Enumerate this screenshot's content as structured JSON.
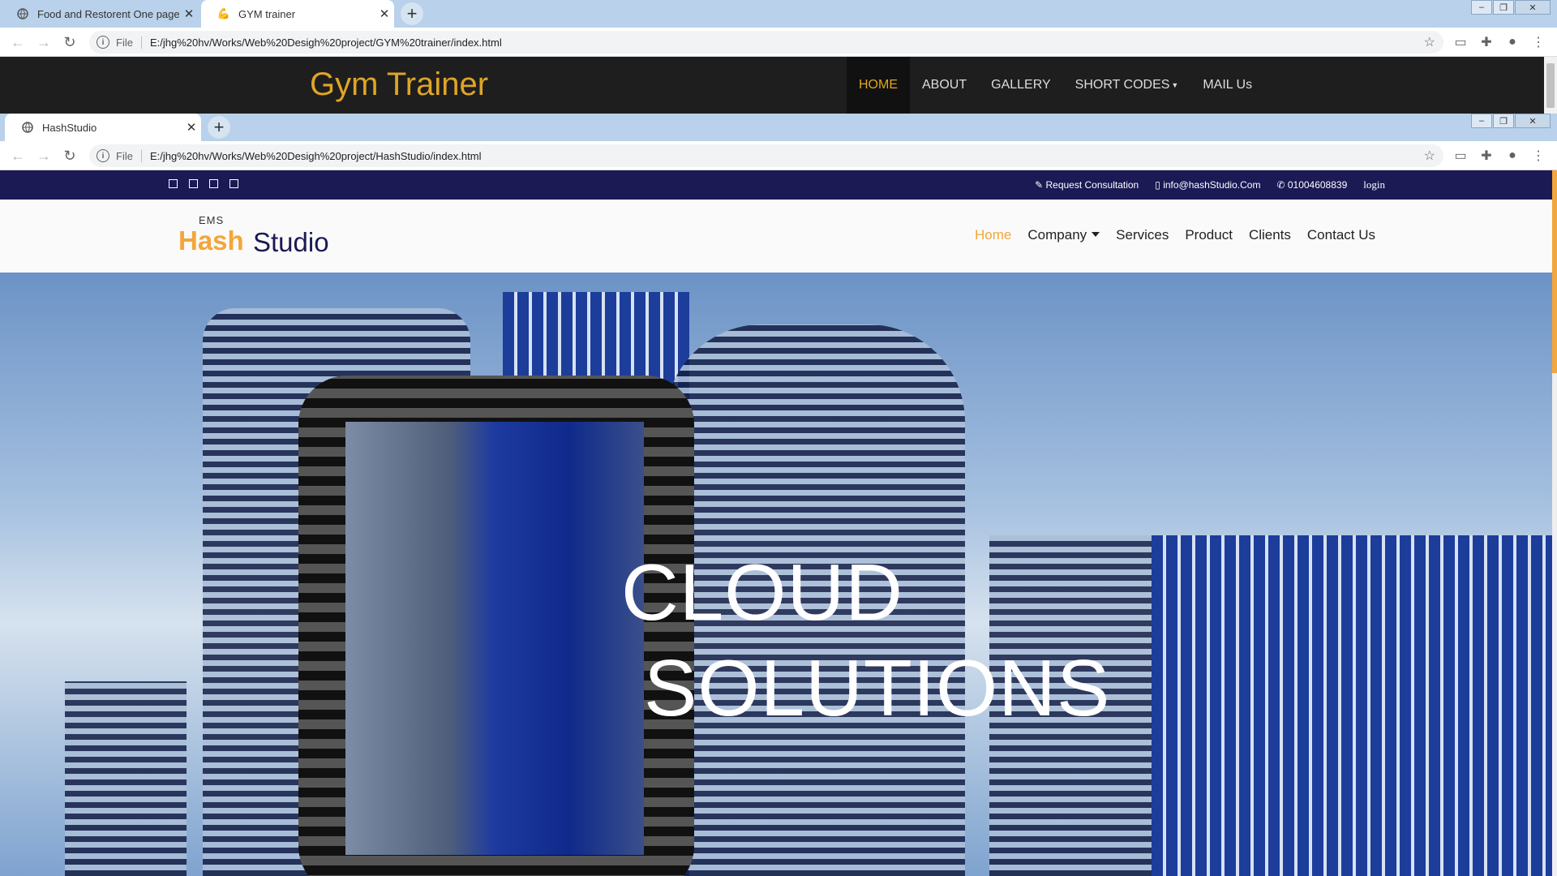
{
  "window1": {
    "tabs": [
      {
        "title": "Food and Restorent One page Te",
        "active": false
      },
      {
        "title": "GYM trainer",
        "active": true
      }
    ],
    "url_scheme": "File",
    "url": "E:/jhg%20hv/Works/Web%20Desigh%20project/GYM%20trainer/index.html"
  },
  "gym": {
    "title": "Gym Trainer",
    "menu": [
      "HOME",
      "ABOUT",
      "GALLERY",
      "SHORT CODES",
      "MAIL Us"
    ],
    "active": "HOME",
    "accent": "#e0a526",
    "bg": "#1e1e1e"
  },
  "window2": {
    "tabs": [
      {
        "title": "HashStudio",
        "active": true
      }
    ],
    "url_scheme": "File",
    "url": "E:/jhg%20hv/Works/Web%20Desigh%20project/HashStudio/index.html"
  },
  "hash": {
    "topbar": {
      "request": "Request Consultation",
      "email": "info@hashStudio.Com",
      "phone": "01004608839",
      "login": "login"
    },
    "logo": {
      "ems": "EMS",
      "hash": "Hash",
      "studio": "Studio"
    },
    "menu": {
      "home": "Home",
      "company": "Company",
      "services": "Services",
      "product": "Product",
      "clients": "Clients",
      "contact": "Contact Us"
    },
    "hero": {
      "line1": "CLOUD",
      "line2": "SOLUTIONS"
    },
    "colors": {
      "navy": "#1b1a55",
      "orange": "#f3a63b"
    }
  }
}
